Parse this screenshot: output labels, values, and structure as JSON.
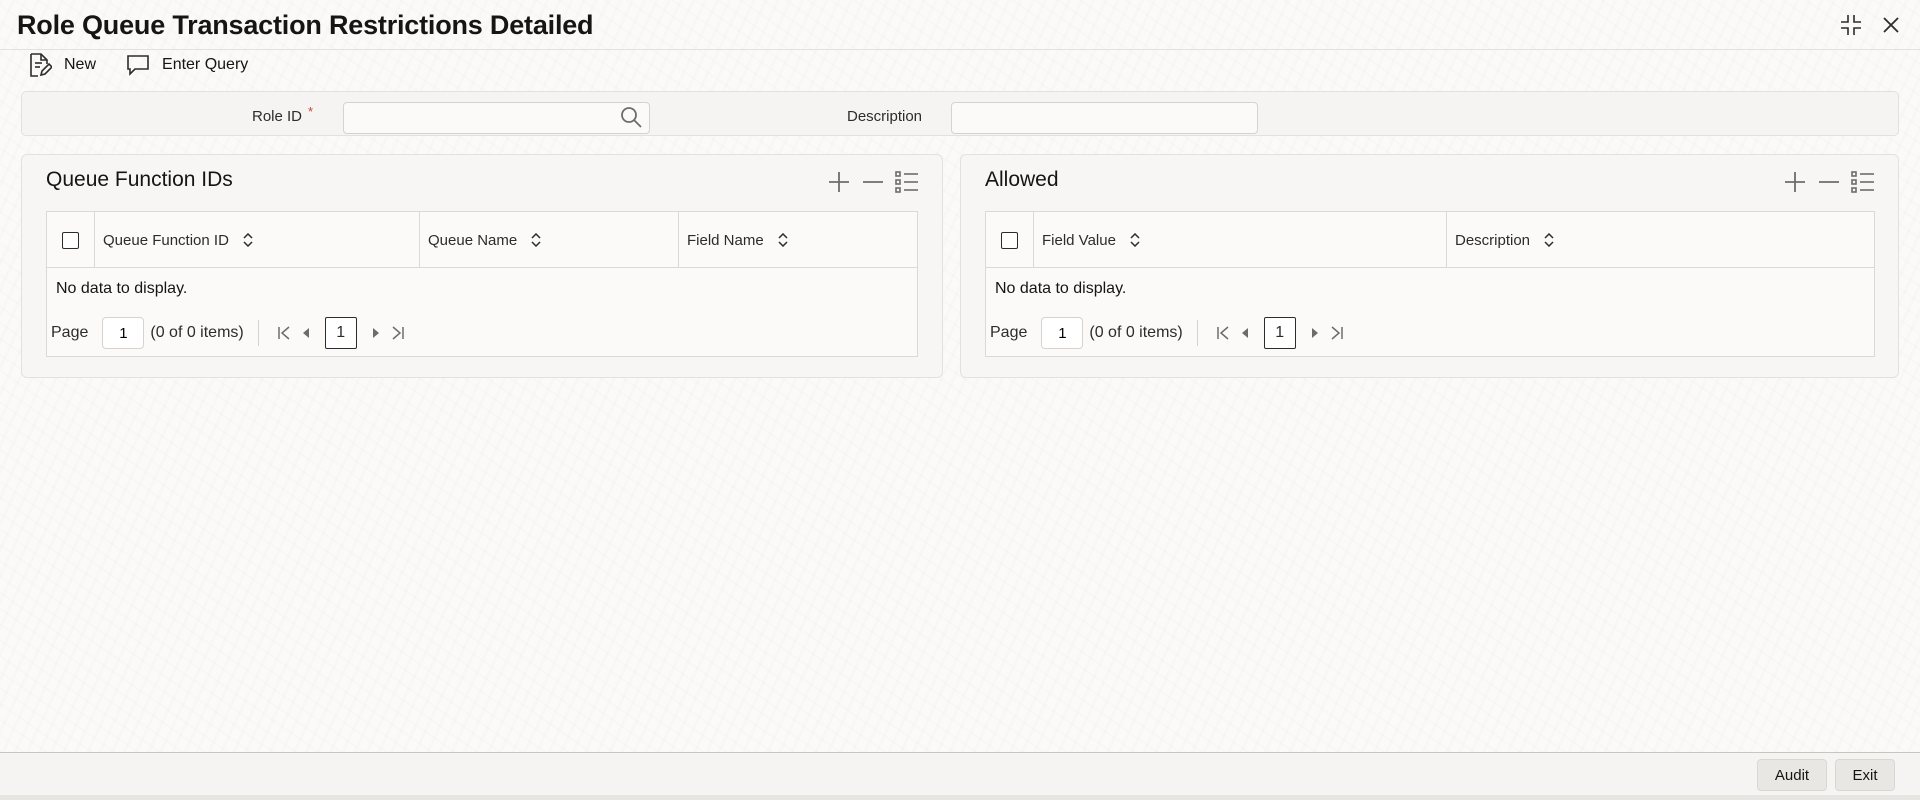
{
  "header": {
    "title": "Role Queue Transaction Restrictions Detailed"
  },
  "window_controls": {
    "icons": [
      "collapse-icon",
      "close-icon"
    ]
  },
  "toolbar": {
    "new_label": "New",
    "enter_query_label": "Enter Query"
  },
  "form": {
    "role_id_label": "Role ID",
    "required_marker": "*",
    "role_id_value": "",
    "description_label": "Description",
    "description_value": ""
  },
  "queue_panel": {
    "title": "Queue Function IDs",
    "columns": [
      "Queue Function ID",
      "Queue Name",
      "Field Name"
    ],
    "empty_text": "No data to display.",
    "pager": {
      "page_label": "Page",
      "page_value": "1",
      "count_text": "(0 of 0 items)",
      "current_page": "1"
    }
  },
  "allowed_panel": {
    "title": "Allowed",
    "columns": [
      "Field Value",
      "Description"
    ],
    "empty_text": "No data to display.",
    "pager": {
      "page_label": "Page",
      "page_value": "1",
      "count_text": "(0 of 0 items)",
      "current_page": "1"
    }
  },
  "footer": {
    "audit_label": "Audit",
    "exit_label": "Exit"
  },
  "colors": {
    "required": "#c74634",
    "text": "#161513",
    "panel_bg": "#f7f6f5",
    "border": "#dcd9d5"
  }
}
